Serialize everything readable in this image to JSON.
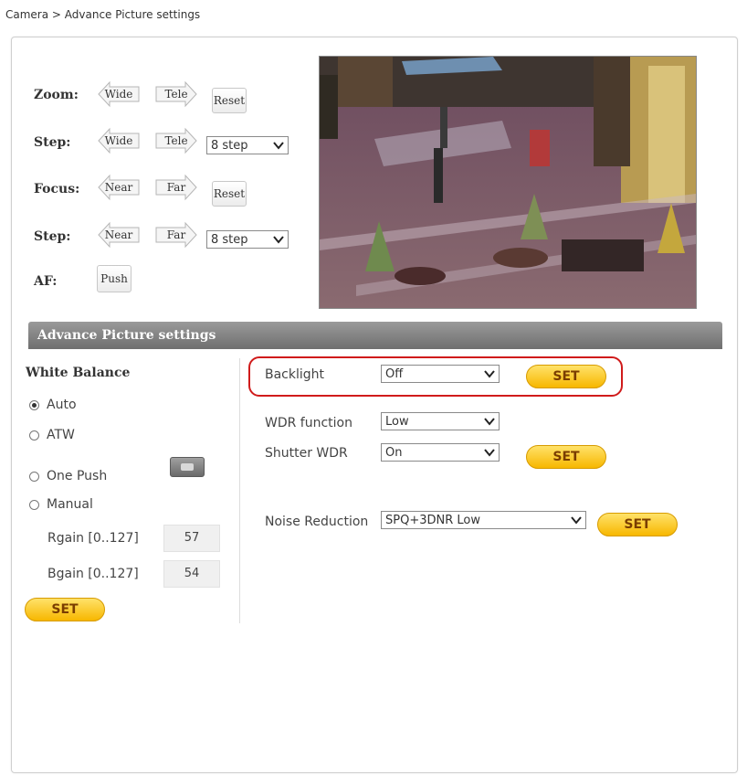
{
  "breadcrumb": "Camera > Advance Picture settings",
  "controls": {
    "zoom": {
      "label": "Zoom:",
      "wide": "Wide",
      "tele": "Tele",
      "reset": "Reset"
    },
    "zoom_step": {
      "label": "Step:",
      "wide": "Wide",
      "tele": "Tele",
      "value": "8 step"
    },
    "focus": {
      "label": "Focus:",
      "near": "Near",
      "far": "Far",
      "reset": "Reset"
    },
    "focus_step": {
      "label": "Step:",
      "near": "Near",
      "far": "Far",
      "value": "8 step"
    },
    "af": {
      "label": "AF:",
      "push": "Push"
    }
  },
  "section_title": "Advance Picture settings",
  "white_balance": {
    "title": "White Balance",
    "options": [
      "Auto",
      "ATW",
      "One Push",
      "Manual"
    ],
    "selected": "Auto",
    "rgain_label": "Rgain [0..127]",
    "rgain_value": "57",
    "bgain_label": "Bgain [0..127]",
    "bgain_value": "54",
    "set_label": "SET"
  },
  "settings": {
    "backlight": {
      "label": "Backlight",
      "value": "Off",
      "set_label": "SET"
    },
    "wdr_function": {
      "label": "WDR function",
      "value": "Low"
    },
    "shutter_wdr": {
      "label": "Shutter WDR",
      "value": "On",
      "set_label": "SET"
    },
    "noise_reduction": {
      "label": "Noise Reduction",
      "value": "SPQ+3DNR Low",
      "set_label": "SET"
    }
  },
  "colors": {
    "set_button": "#f7b700",
    "highlight": "#d01b1b",
    "section_bar": "#7d7d7d"
  },
  "icons": {
    "arrow_left": "arrow-left-button",
    "arrow_right": "arrow-right-button",
    "select_chevron": "chevron-down-icon"
  }
}
